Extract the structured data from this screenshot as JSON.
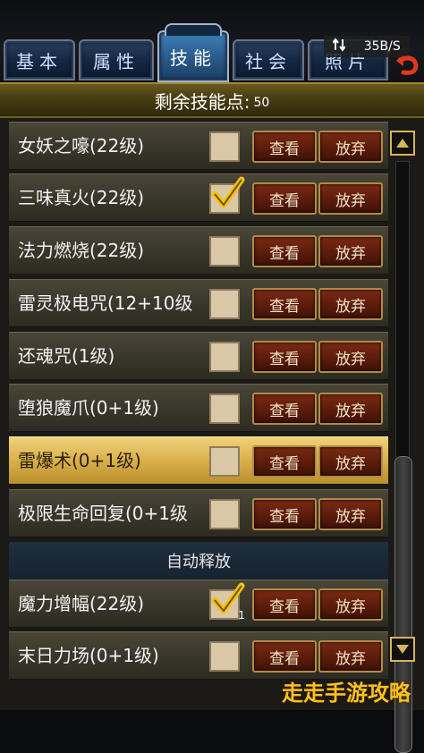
{
  "tabs": [
    {
      "label": "基本"
    },
    {
      "label": "属性"
    },
    {
      "label": "技能"
    },
    {
      "label": "社会"
    },
    {
      "label": "照片"
    }
  ],
  "status": {
    "speed": "35B/S"
  },
  "header": {
    "label": "剩余技能点:",
    "value": "50"
  },
  "buttons": {
    "view": "查看",
    "drop": "放弃"
  },
  "skills": [
    {
      "name": "女妖之嚎(22级)",
      "checked": false
    },
    {
      "name": "三味真火(22级)",
      "checked": true
    },
    {
      "name": "法力燃烧(22级)",
      "checked": false
    },
    {
      "name": "雷灵极电咒(12+10级",
      "checked": false
    },
    {
      "name": "还魂咒(1级)",
      "checked": false
    },
    {
      "name": "堕狼魔爪(0+1级)",
      "checked": false
    },
    {
      "name": "雷爆术(0+1级)",
      "checked": false,
      "selected": true
    },
    {
      "name": "极限生命回复(0+1级",
      "checked": false
    }
  ],
  "section": {
    "label": "自动释放"
  },
  "auto_skills": [
    {
      "name": "魔力增幅(22级)",
      "checked": true,
      "count": "1"
    },
    {
      "name": "末日力场(0+1级)",
      "checked": false
    }
  ],
  "watermark": "走走手游攻略",
  "colors": {
    "accent": "#d9b04c",
    "button": "#5b1c0b",
    "tab_active": "#2a5d8e"
  }
}
